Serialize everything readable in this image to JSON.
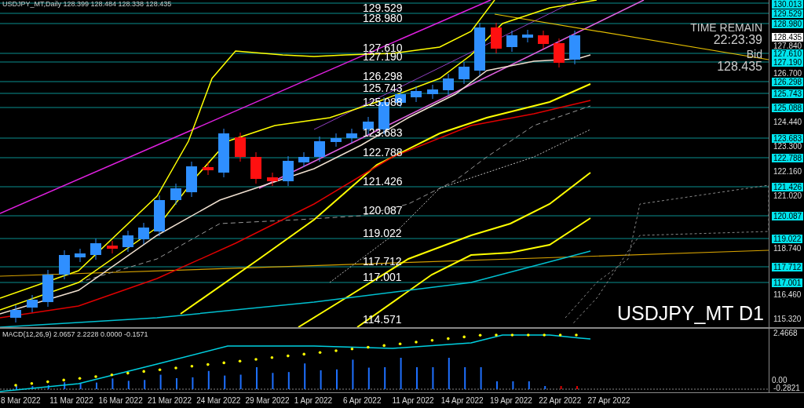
{
  "header": {
    "symbol_info": "USDJPY_MT,Daily 128.399 128.484 128.338 128.435"
  },
  "info_panel": {
    "time_label": "TIME REMAIN",
    "time_value": "22:23:39",
    "bid_label": "Bid",
    "bid_value": "128.435"
  },
  "symbol_label": "USDJPY_MT D1",
  "level_lines": [
    {
      "axis_label": "130.013"
    },
    {
      "axis_label": "129.529",
      "chart_label": "129.529"
    },
    {
      "axis_label": "128.980",
      "chart_label": "128.980"
    },
    {
      "axis_label": "127.610",
      "chart_label": "127.610"
    },
    {
      "axis_label": "127.190",
      "chart_label": "127.190"
    },
    {
      "axis_label": "126.298",
      "chart_label": "126.298"
    },
    {
      "axis_label": "125.743",
      "chart_label": "125.743"
    },
    {
      "axis_label": "125.088",
      "chart_label": "125.088"
    },
    {
      "axis_label": "123.683",
      "chart_label": "123.683"
    },
    {
      "axis_label": "122.788",
      "chart_label": "122.788"
    },
    {
      "axis_label": "121.426",
      "chart_label": "121.426"
    },
    {
      "axis_label": "120.087",
      "chart_label": "120.087"
    },
    {
      "axis_label": "119.022",
      "chart_label": "119.022"
    },
    {
      "axis_label": "117.712",
      "chart_label": "117.712"
    },
    {
      "axis_label": "117.001",
      "chart_label": "117.001"
    },
    {
      "chart_label": "114.571"
    }
  ],
  "price_axis": {
    "current_price": "128.435",
    "ticks": [
      "127.840",
      "126.700",
      "124.440",
      "123.300",
      "122.160",
      "121.020",
      "118.740",
      "116.460",
      "115.320"
    ]
  },
  "macd": {
    "title": "MACD(12,26,9) 2.0657 2.2228 0.0000 -0.1571",
    "axis_labels": [
      "2.4668",
      "0.00",
      "-0.2821"
    ]
  },
  "date_axis": [
    "8 Mar 2022",
    "11 Mar 2022",
    "16 Mar 2022",
    "21 Mar 2022",
    "24 Mar 2022",
    "29 Mar 2022",
    "1 Apr 2022",
    "6 Apr 2022",
    "11 Apr 2022",
    "14 Apr 2022",
    "19 Apr 2022",
    "22 Apr 2022",
    "27 Apr 2022"
  ]
}
